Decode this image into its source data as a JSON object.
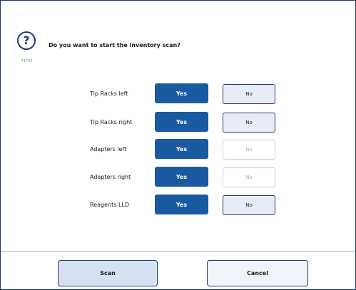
{
  "dialog": {
    "icon": "question-icon",
    "icon_glyph": "?",
    "message_id": "71702",
    "prompt": "Do you want to start the inventory scan?"
  },
  "options": [
    {
      "label": "Tip Racks left",
      "yes": "Yes",
      "no": "No",
      "no_enabled": true
    },
    {
      "label": "Tip Racks right",
      "yes": "Yes",
      "no": "No",
      "no_enabled": true
    },
    {
      "label": "Adapters left",
      "yes": "Yes",
      "no": "No",
      "no_enabled": false
    },
    {
      "label": "Adapters right",
      "yes": "Yes",
      "no": "No",
      "no_enabled": false
    },
    {
      "label": "Reagents LLD",
      "yes": "Yes",
      "no": "No",
      "no_enabled": true
    }
  ],
  "footer": {
    "scan_label": "Scan",
    "cancel_label": "Cancel"
  },
  "colors": {
    "accent": "#1a5aa0",
    "border": "#1f3c72",
    "no_button_bg": "#e6edf7",
    "divider": "#8cb1d8"
  }
}
